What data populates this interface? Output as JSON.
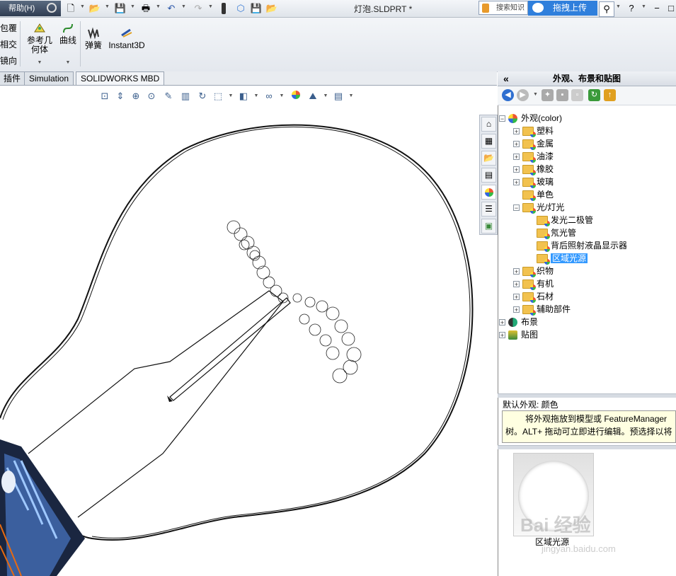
{
  "titlebar": {
    "help": "帮助(H)",
    "doc_title": "灯泡.SLDPRT *",
    "search_placeholder": "搜索知识",
    "upload": "拖拽上传"
  },
  "ribbon": {
    "left_items": [
      "包覆",
      "相交",
      "镜向"
    ],
    "ref_geometry": "参考几\n何体",
    "curves": "曲线",
    "spring": "弹簧",
    "instant3d": "Instant3D"
  },
  "tabs": [
    "插件",
    "Simulation",
    "SOLIDWORKS MBD"
  ],
  "panel": {
    "title": "外观、布景和贴图",
    "tree": [
      {
        "label": "外观(color)",
        "level": 0,
        "expander": "−",
        "icon": "ball",
        "selected": false
      },
      {
        "label": "塑料",
        "level": 1,
        "expander": "+",
        "icon": "folder",
        "selected": false
      },
      {
        "label": "金属",
        "level": 1,
        "expander": "+",
        "icon": "folder",
        "selected": false
      },
      {
        "label": "油漆",
        "level": 1,
        "expander": "+",
        "icon": "folder",
        "selected": false
      },
      {
        "label": "橡胶",
        "level": 1,
        "expander": "+",
        "icon": "folder",
        "selected": false
      },
      {
        "label": "玻璃",
        "level": 1,
        "expander": "+",
        "icon": "folder",
        "selected": false
      },
      {
        "label": "单色",
        "level": 1,
        "expander": "",
        "icon": "folder",
        "selected": false
      },
      {
        "label": "光/灯光",
        "level": 1,
        "expander": "−",
        "icon": "folder",
        "selected": false
      },
      {
        "label": "发光二极管",
        "level": 2,
        "expander": "",
        "icon": "folder",
        "selected": false
      },
      {
        "label": "氖光管",
        "level": 2,
        "expander": "",
        "icon": "folder",
        "selected": false
      },
      {
        "label": "背后照射液晶显示器",
        "level": 2,
        "expander": "",
        "icon": "folder",
        "selected": false
      },
      {
        "label": "区域光源",
        "level": 2,
        "expander": "",
        "icon": "folder",
        "selected": true
      },
      {
        "label": "织物",
        "level": 1,
        "expander": "+",
        "icon": "folder",
        "selected": false
      },
      {
        "label": "有机",
        "level": 1,
        "expander": "+",
        "icon": "folder",
        "selected": false
      },
      {
        "label": "石材",
        "level": 1,
        "expander": "+",
        "icon": "folder",
        "selected": false
      },
      {
        "label": "辅助部件",
        "level": 1,
        "expander": "+",
        "icon": "folder",
        "selected": false
      },
      {
        "label": "布景",
        "level": 0,
        "expander": "+",
        "icon": "scene",
        "selected": false
      },
      {
        "label": "贴图",
        "level": 0,
        "expander": "+",
        "icon": "decal",
        "selected": false
      }
    ],
    "status_label": "默认外观: 颜色",
    "hint": "将外观拖放到模型或 FeatureManager 树。ALT+ 拖动可立即进行编辑。预选择以将",
    "swatch_caption": "区域光源"
  },
  "watermark": {
    "brand": "Bai 经验",
    "url": "jingyan.baidu.com"
  }
}
